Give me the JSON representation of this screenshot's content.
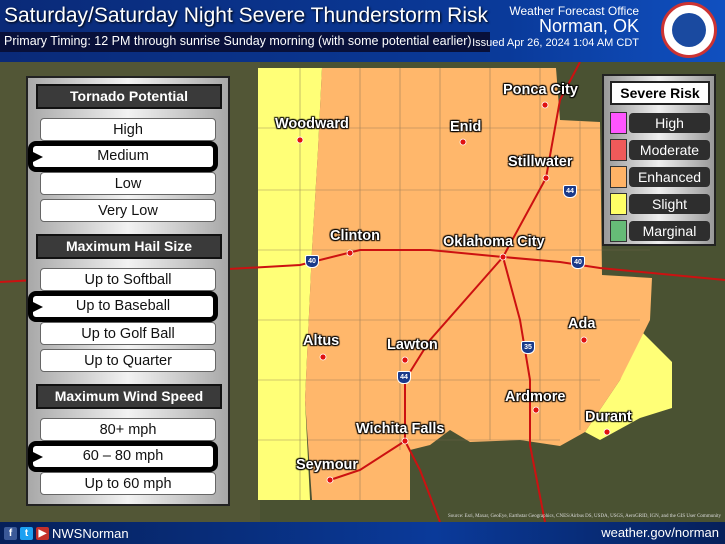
{
  "header": {
    "title": "Saturday/Saturday Night Severe Thunderstorm Risk",
    "timing": "Primary Timing: 12 PM through sunrise Sunday morning (with some potential earlier)",
    "office": "Weather Forecast Office",
    "city": "Norman, OK",
    "issued": "Issued Apr 26, 2024 1:04 AM CDT",
    "logo_text": "NATIONAL WEATHER SERVICE"
  },
  "panel": {
    "tornado": {
      "title": "Tornado Potential",
      "options": [
        "High",
        "Medium",
        "Low",
        "Very Low"
      ],
      "selected": "Medium"
    },
    "hail": {
      "title": "Maximum Hail Size",
      "options": [
        "Up to Softball",
        "Up to Baseball",
        "Up to Golf Ball",
        "Up to Quarter"
      ],
      "selected": "Up to Baseball"
    },
    "wind": {
      "title": "Maximum Wind Speed",
      "options": [
        "80+ mph",
        "60 – 80 mph",
        "Up to 60 mph"
      ],
      "selected": "60 – 80 mph"
    }
  },
  "legend": {
    "title": "Severe Risk",
    "items": [
      {
        "label": "High",
        "color": "#ff55ff"
      },
      {
        "label": "Moderate",
        "color": "#f05a5a"
      },
      {
        "label": "Enhanced",
        "color": "#ffb366"
      },
      {
        "label": "Slight",
        "color": "#ffff66"
      },
      {
        "label": "Marginal",
        "color": "#66bb77"
      }
    ]
  },
  "cities": [
    "Woodward",
    "Enid",
    "Ponca City",
    "Stillwater",
    "Clinton",
    "Oklahoma City",
    "Altus",
    "Lawton",
    "Ada",
    "Ardmore",
    "Durant",
    "Wichita Falls",
    "Seymour"
  ],
  "interstates": [
    "40",
    "40",
    "44",
    "35",
    "44"
  ],
  "footer": {
    "handle": "NWSNorman",
    "site": "weather.gov/norman",
    "attribution": "Source: Esri, Maxar, GeoEye, Earthstar Geographics, CNES/Airbus DS, USDA, USGS, AeroGRID, IGN, and the GIS User Community"
  }
}
